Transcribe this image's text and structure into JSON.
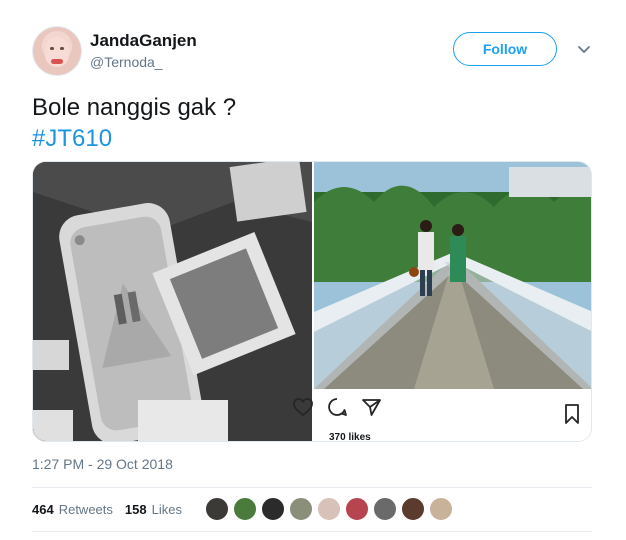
{
  "user": {
    "name": "JandaGanjen",
    "handle": "@Ternoda_"
  },
  "follow_label": "Follow",
  "tweet": {
    "text": "Bole nanggis gak ?",
    "hashtag": "#JT610"
  },
  "instagram": {
    "likes": "370 likes"
  },
  "timestamp": "1:27 PM - 29 Oct 2018",
  "stats": {
    "retweets_count": "464",
    "retweets_label": "Retweets",
    "likes_count": "158",
    "likes_label": "Likes"
  },
  "likers": [
    "#3b3a36",
    "#4a7a3c",
    "#2b2b2b",
    "#8a8f7a",
    "#d7c1b8",
    "#b7454f",
    "#6a6a6a",
    "#5a3b2e",
    "#c9b29a"
  ],
  "colors": {
    "accent": "#1da1f2",
    "hashtag": "#1b95e0",
    "muted": "#657786"
  }
}
